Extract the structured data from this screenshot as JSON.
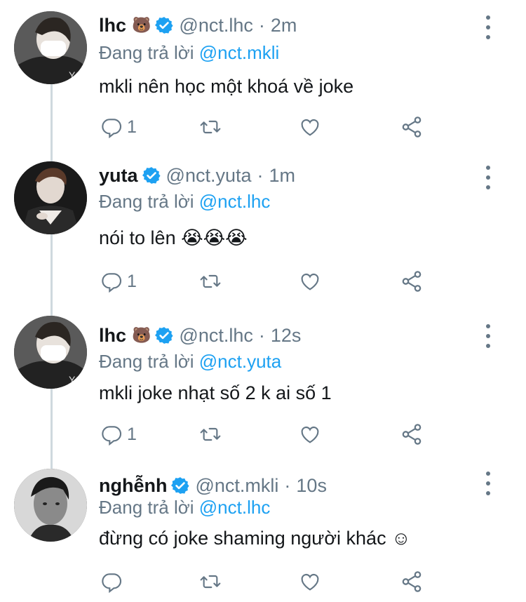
{
  "tweets": [
    {
      "name": "lhc",
      "emoji": "🐻",
      "handle": "@nct.lhc",
      "time": "2m",
      "reply_prefix": "Đang trả lời ",
      "reply_to": "@nct.mkli",
      "text": "mkli nên học một khoá về joke",
      "reply_count": "1"
    },
    {
      "name": "yuta",
      "emoji": "",
      "handle": "@nct.yuta",
      "time": "1m",
      "reply_prefix": "Đang trả lời ",
      "reply_to": "@nct.lhc",
      "text": "nói to lên 😭😭😭",
      "reply_count": "1"
    },
    {
      "name": "lhc",
      "emoji": "🐻",
      "handle": "@nct.lhc",
      "time": "12s",
      "reply_prefix": "Đang trả lời ",
      "reply_to": "@nct.yuta",
      "text": "mkli joke nhạt số 2 k ai số 1",
      "reply_count": "1"
    },
    {
      "name": "nghễnh",
      "emoji": "",
      "handle": "@nct.mkli",
      "time": "10s",
      "reply_prefix": "Đang trả lời ",
      "reply_to": "@nct.lhc",
      "text": "đừng có joke shaming người khác ☺",
      "reply_count": ""
    }
  ],
  "separator": "·",
  "colors": {
    "accent": "#1da1f2",
    "secondary_text": "#657786",
    "thread_line": "#cfd9de"
  },
  "icons": [
    "verified-badge-icon",
    "more-options-icon",
    "reply-icon",
    "retweet-icon",
    "like-icon",
    "share-icon"
  ]
}
